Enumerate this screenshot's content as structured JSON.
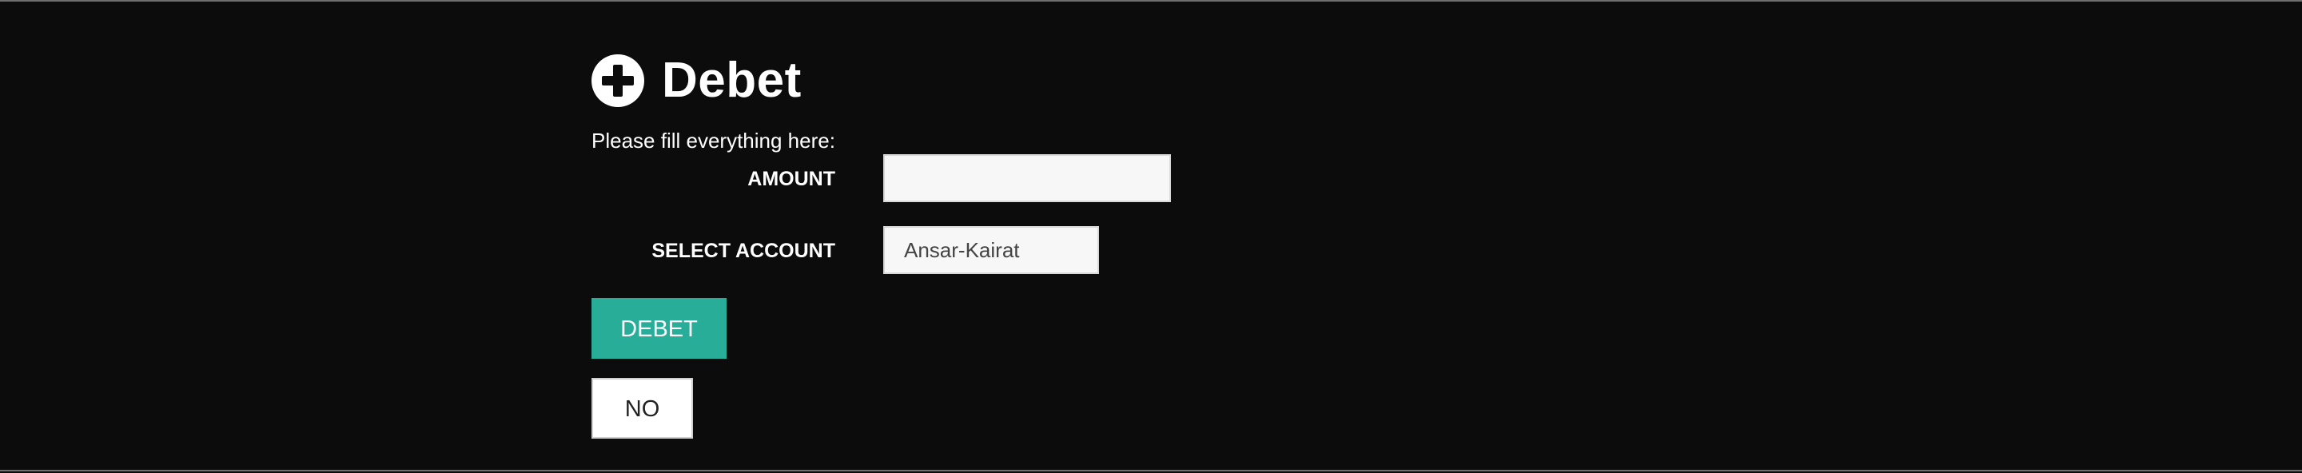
{
  "page": {
    "title": "Debet",
    "icon": "plus-circle-icon",
    "instructions": "Please fill everything here:"
  },
  "form": {
    "amount": {
      "label": "AMOUNT",
      "value": "",
      "placeholder": ""
    },
    "account": {
      "label": "SELECT ACCOUNT",
      "selected": "Ansar-Kairat"
    }
  },
  "buttons": {
    "submit_label": "DEBET",
    "cancel_label": "NO"
  },
  "colors": {
    "background": "#0c0c0c",
    "accent": "#27ad98",
    "text": "#ffffff",
    "input_bg": "#f7f7f7"
  }
}
